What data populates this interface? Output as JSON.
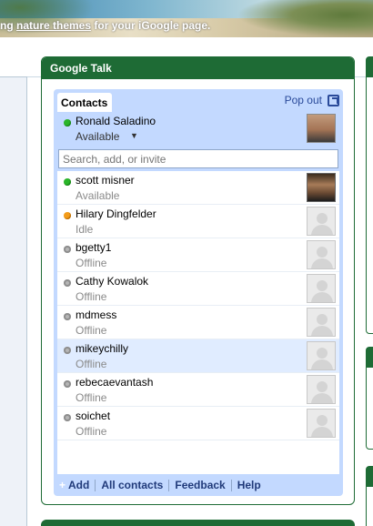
{
  "banner": {
    "text_before": "ng ",
    "link": "nature themes",
    "text_after": " for your iGoogle page."
  },
  "gadget": {
    "title": "Google Talk"
  },
  "talk": {
    "tab_label": "Contacts",
    "popout_label": "Pop out",
    "me": {
      "name": "Ronald Saladino",
      "status": "Available",
      "status_color": "#2ab52a"
    },
    "search_placeholder": "Search, add, or invite",
    "contacts": [
      {
        "name": "scott misner",
        "status": "Available",
        "presence": "available",
        "avatar": "photo"
      },
      {
        "name": "Hilary Dingfelder",
        "status": "Idle",
        "presence": "idle",
        "avatar": "placeholder"
      },
      {
        "name": "bgetty1",
        "status": "Offline",
        "presence": "offline",
        "avatar": "placeholder"
      },
      {
        "name": "Cathy Kowalok",
        "status": "Offline",
        "presence": "offline",
        "avatar": "placeholder"
      },
      {
        "name": "mdmess",
        "status": "Offline",
        "presence": "offline",
        "avatar": "placeholder"
      },
      {
        "name": "mikeychilly",
        "status": "Offline",
        "presence": "offline",
        "avatar": "placeholder",
        "selected": true
      },
      {
        "name": "rebecaevantash",
        "status": "Offline",
        "presence": "offline",
        "avatar": "placeholder"
      },
      {
        "name": "soichet",
        "status": "Offline",
        "presence": "offline",
        "avatar": "placeholder"
      }
    ],
    "footer": {
      "add": "Add",
      "all_contacts": "All contacts",
      "feedback": "Feedback",
      "help": "Help"
    }
  },
  "colors": {
    "gadget_header": "#1e6b35",
    "talk_background": "#c3d9ff",
    "available": "#2ab52a",
    "idle": "#f39c1a",
    "offline": "#b5b5b5",
    "link": "#2a4a9a"
  }
}
